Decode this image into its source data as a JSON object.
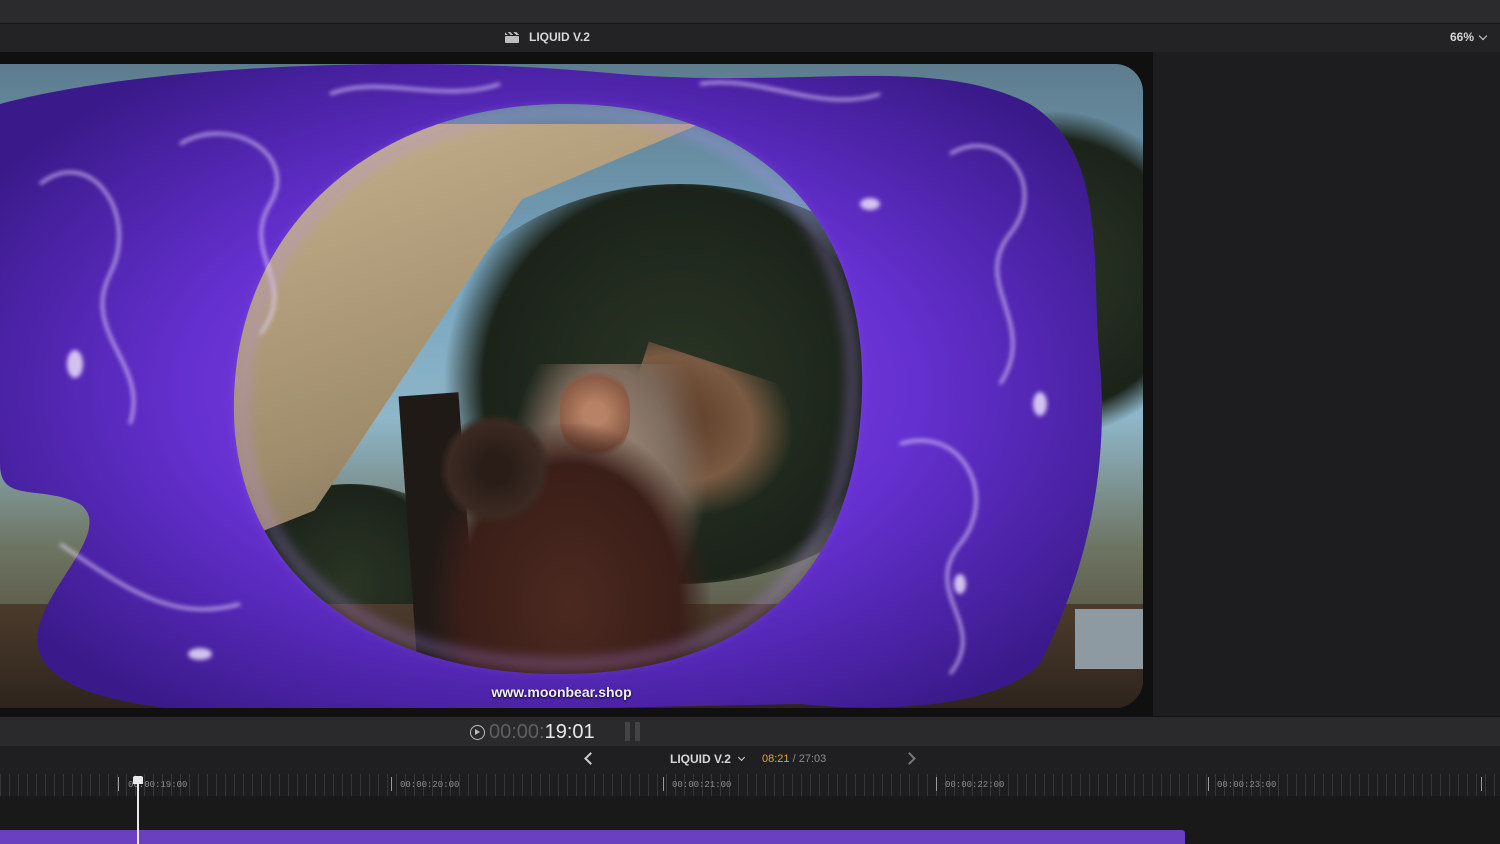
{
  "viewer": {
    "title": "LIQUID V.2",
    "zoom": "66%",
    "watermark": "www.moonbear.shop"
  },
  "timecode": {
    "dim": "00:00:",
    "bright": "19:01"
  },
  "timeline": {
    "project": "LIQUID V.2",
    "duration_current": "08:21",
    "duration_separator": " / ",
    "duration_total": "27:03",
    "ruler_labels": [
      "00:00:19:00",
      "00:00:20:00",
      "00:00:21:00",
      "00:00:22:00",
      "00:00:23:00"
    ]
  },
  "colors": {
    "clip_accent": "#6b3fc0",
    "duration_current": "#d9a640"
  },
  "icons": {
    "clapper": "clapperboard-icon",
    "timecode": "play-clock-icon",
    "pause": "pause-icon",
    "prev": "chevron-left-icon",
    "next": "chevron-right-icon"
  }
}
